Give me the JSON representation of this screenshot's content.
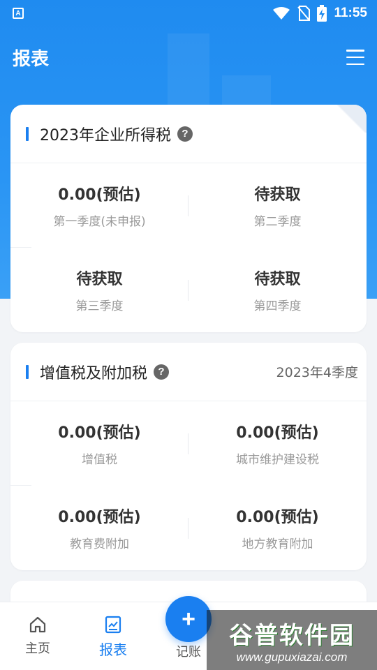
{
  "status_bar": {
    "app_badge": "A",
    "time": "11:55"
  },
  "header": {
    "title": "报表"
  },
  "cards": [
    {
      "title": "2023年企业所得税",
      "period": "",
      "cells": [
        {
          "value": "0.00(预估)",
          "label": "第一季度(未申报)"
        },
        {
          "value": "待获取",
          "label": "第二季度"
        },
        {
          "value": "待获取",
          "label": "第三季度"
        },
        {
          "value": "待获取",
          "label": "第四季度"
        }
      ]
    },
    {
      "title": "增值税及附加税",
      "period": "2023年4季度",
      "cells": [
        {
          "value": "0.00(预估)",
          "label": "增值税"
        },
        {
          "value": "0.00(预估)",
          "label": "城市维护建设税"
        },
        {
          "value": "0.00(预估)",
          "label": "教育费附加"
        },
        {
          "value": "0.00(预估)",
          "label": "地方教育附加"
        }
      ]
    }
  ],
  "bottom_nav": {
    "items": [
      {
        "label": "主页",
        "icon": "home-icon"
      },
      {
        "label": "报表",
        "icon": "report-icon",
        "active": true
      },
      {
        "label": "记账",
        "icon": "plus-icon"
      }
    ]
  },
  "watermark": {
    "title": "谷普软件园",
    "url": "www.gupuxiazai.com"
  },
  "colors": {
    "accent": "#1a7ff0",
    "header_bg": "#1f8bf0"
  }
}
